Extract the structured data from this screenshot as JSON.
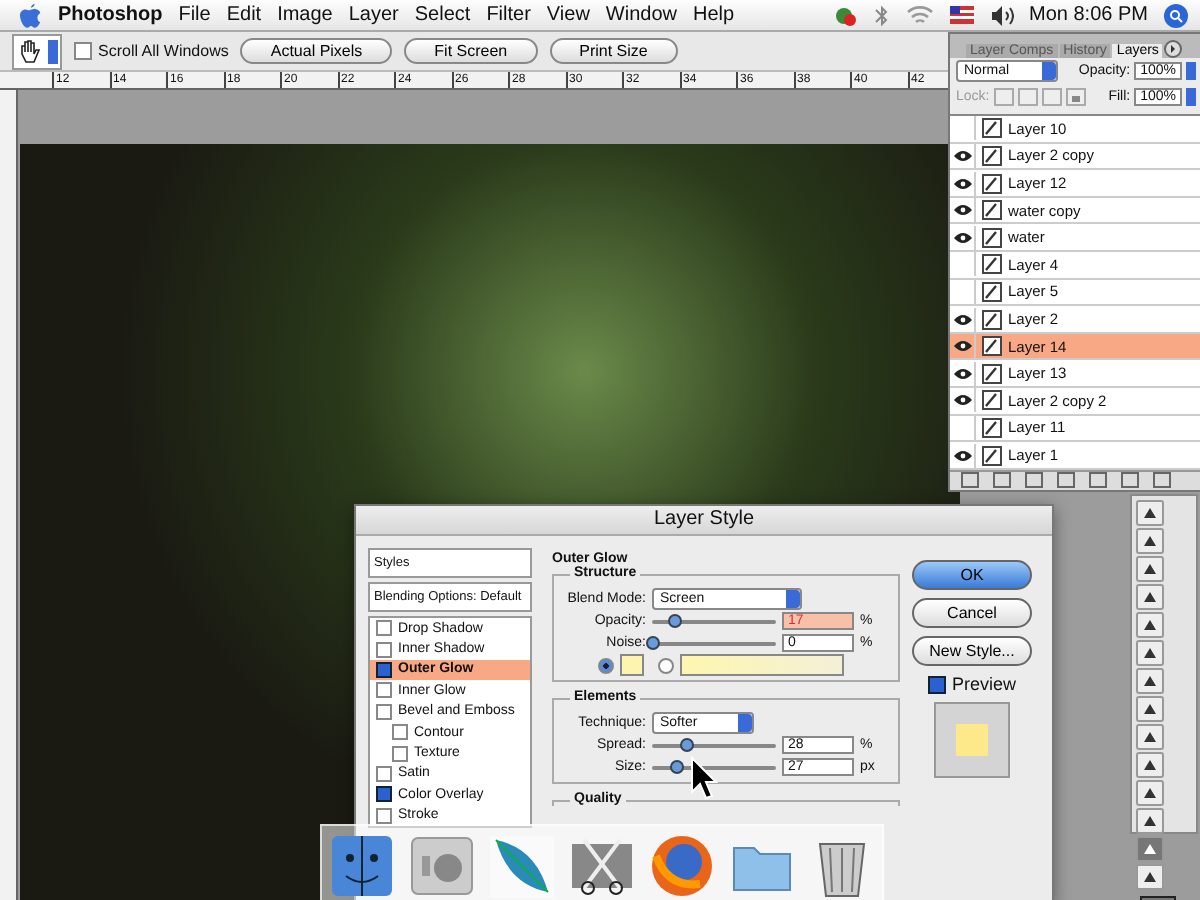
{
  "menu_bar": {
    "app": "Photoshop",
    "items": [
      "File",
      "Edit",
      "Image",
      "Layer",
      "Select",
      "Filter",
      "View",
      "Window",
      "Help"
    ],
    "clock": "Mon 8:06 PM"
  },
  "options_bar": {
    "scroll_all": {
      "label": "Scroll All Windows",
      "checked": false
    },
    "buttons": [
      "Actual Pixels",
      "Fit Screen",
      "Print Size"
    ]
  },
  "ruler": {
    "labels": [
      "12",
      "14",
      "16",
      "18",
      "20",
      "22",
      "24",
      "26",
      "28",
      "30",
      "32",
      "34",
      "36",
      "38",
      "40",
      "42"
    ]
  },
  "layers_palette": {
    "tabs": [
      {
        "label": "Layer Comps",
        "selected": false
      },
      {
        "label": "History",
        "selected": false
      },
      {
        "label": "Layers",
        "selected": true
      }
    ],
    "blend_mode": "Normal",
    "opacity_label": "Opacity:",
    "opacity": "100%",
    "lock_label": "Lock:",
    "fill_label": "Fill:",
    "fill": "100%",
    "layers": [
      {
        "name": "Layer 10",
        "visible": false,
        "selected": false
      },
      {
        "name": "Layer 2 copy",
        "visible": true,
        "selected": false
      },
      {
        "name": "Layer 12",
        "visible": true,
        "selected": false
      },
      {
        "name": "water copy",
        "visible": true,
        "selected": false
      },
      {
        "name": "water",
        "visible": true,
        "selected": false
      },
      {
        "name": "Layer 4",
        "visible": false,
        "selected": false
      },
      {
        "name": "Layer 5",
        "visible": false,
        "selected": false
      },
      {
        "name": "Layer 2",
        "visible": true,
        "selected": false
      },
      {
        "name": "Layer 14",
        "visible": true,
        "selected": true
      },
      {
        "name": "Layer 13",
        "visible": true,
        "selected": false
      },
      {
        "name": "Layer 2 copy 2",
        "visible": true,
        "selected": false
      },
      {
        "name": "Layer 11",
        "visible": false,
        "selected": false
      },
      {
        "name": "Layer 1",
        "visible": true,
        "selected": false
      }
    ]
  },
  "layer_style": {
    "title": "Layer Style",
    "styles_header": "Styles",
    "blending_options": "Blending Options: Default",
    "effects": [
      {
        "label": "Drop Shadow",
        "checked": false,
        "selected": false
      },
      {
        "label": "Inner Shadow",
        "checked": false,
        "selected": false
      },
      {
        "label": "Outer Glow",
        "checked": true,
        "selected": true
      },
      {
        "label": "Inner Glow",
        "checked": false,
        "selected": false
      },
      {
        "label": "Bevel and Emboss",
        "checked": false,
        "selected": false,
        "children": [
          {
            "label": "Contour",
            "checked": false,
            "selected": false
          },
          {
            "label": "Texture",
            "checked": false,
            "selected": false
          }
        ]
      },
      {
        "label": "Satin",
        "checked": false,
        "selected": false
      },
      {
        "label": "Color Overlay",
        "checked": true,
        "selected": false
      },
      {
        "label": "Stroke",
        "checked": false,
        "selected": false
      }
    ],
    "section_title": "Outer Glow",
    "structure": {
      "title": "Structure",
      "blend_label": "Blend Mode:",
      "blend_mode": "Screen",
      "sliders": [
        {
          "label": "Opacity:",
          "value": "17",
          "unit": "%",
          "level": 0.17,
          "highlighted": true
        },
        {
          "label": "Noise:",
          "value": "0",
          "unit": "%",
          "level": 0,
          "highlighted": false
        }
      ],
      "fill_options": [
        {
          "kind": "color",
          "selected": true
        },
        {
          "kind": "gradient",
          "selected": false
        }
      ]
    },
    "elements": {
      "title": "Elements",
      "technique_label": "Technique:",
      "technique": "Softer",
      "sliders": [
        {
          "label": "Spread:",
          "value": "28",
          "unit": "%",
          "level": 0.28,
          "highlighted": false
        },
        {
          "label": "Size:",
          "value": "27",
          "unit": "px",
          "level": 0.2,
          "highlighted": false
        }
      ]
    },
    "quality": {
      "title": "Quality"
    },
    "buttons": [
      {
        "label": "OK",
        "default": true
      },
      {
        "label": "Cancel",
        "default": false
      },
      {
        "label": "New Style...",
        "default": false
      }
    ],
    "preview": {
      "label": "Preview",
      "checked": true
    }
  }
}
